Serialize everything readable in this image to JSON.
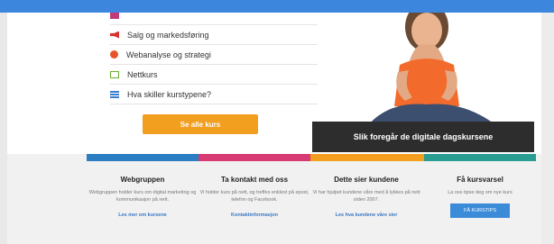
{
  "menu": {
    "items": [
      {
        "label": "",
        "icon": "partial-icon"
      },
      {
        "label": "Salg og markedsføring",
        "icon": "megaphone-icon"
      },
      {
        "label": "Webanalyse og strategi",
        "icon": "pie-chart-icon"
      },
      {
        "label": "Nettkurs",
        "icon": "monitor-icon"
      },
      {
        "label": "Hva skiller kurstypene?",
        "icon": "list-icon"
      }
    ]
  },
  "cta": {
    "see_all_label": "Se alle kurs"
  },
  "hero": {
    "banner_text": "Slik foregår de digitale dagskursene"
  },
  "colors": {
    "top_bar": "#3d86dd",
    "orange": "#f29e1f",
    "stripe_blue": "#2c7ec4",
    "stripe_pink": "#d83a73",
    "stripe_orange": "#f29e1f",
    "stripe_teal": "#2a9d92"
  },
  "footer": {
    "columns": [
      {
        "title": "Webgruppen",
        "text": "Webgruppen holder kurs om digital marketing og kommunikasjon på nett.",
        "link": "Les mer om kursene"
      },
      {
        "title": "Ta kontakt med oss",
        "text": "Vi holder kurs på nett, og treffes enklest på epost, telefon og Facebook.",
        "link": "Kontaktinformasjon"
      },
      {
        "title": "Dette sier kundene",
        "text": "Vi har hjulpet kundene våre med å lykkes på nett siden 2007.",
        "link": "Les hva kundene våre sier"
      },
      {
        "title": "Få kursvarsel",
        "text": "La oss tipse deg om nye kurs",
        "button": "FÅ KURSTIPS"
      }
    ]
  }
}
